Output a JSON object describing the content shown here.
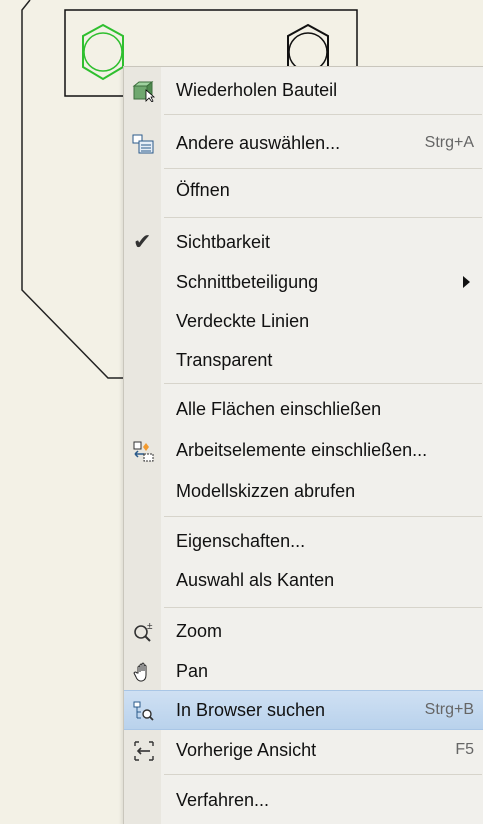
{
  "menu": {
    "items": [
      {
        "label": "Wiederholen Bauteil",
        "icon": "repeat-part-icon"
      },
      {
        "label": "Andere auswählen...",
        "shortcut": "Strg+A",
        "icon": "select-other-icon"
      },
      {
        "label": "Öffnen"
      },
      {
        "label": "Sichtbarkeit",
        "checked": true
      },
      {
        "label": "Schnittbeteiligung",
        "submenu": true
      },
      {
        "label": "Verdeckte Linien"
      },
      {
        "label": "Transparent"
      },
      {
        "label": "Alle Flächen einschließen"
      },
      {
        "label": "Arbeitselemente einschließen...",
        "icon": "work-features-icon"
      },
      {
        "label": "Modellskizzen abrufen"
      },
      {
        "label": "Eigenschaften..."
      },
      {
        "label": "Auswahl als Kanten"
      },
      {
        "label": "Zoom",
        "icon": "zoom-icon"
      },
      {
        "label": "Pan",
        "icon": "pan-hand-icon"
      },
      {
        "label": "In Browser suchen",
        "shortcut": "Strg+B",
        "icon": "find-in-browser-icon",
        "highlighted": true
      },
      {
        "label": "Vorherige Ansicht",
        "shortcut": "F5",
        "icon": "previous-view-icon"
      },
      {
        "label": "Verfahren..."
      }
    ]
  },
  "colors": {
    "background": "#f3f1e6",
    "menu_bg": "#f1f0ec",
    "highlight": "#c4d9f0",
    "hexagon_selected": "#2fbf2f"
  }
}
